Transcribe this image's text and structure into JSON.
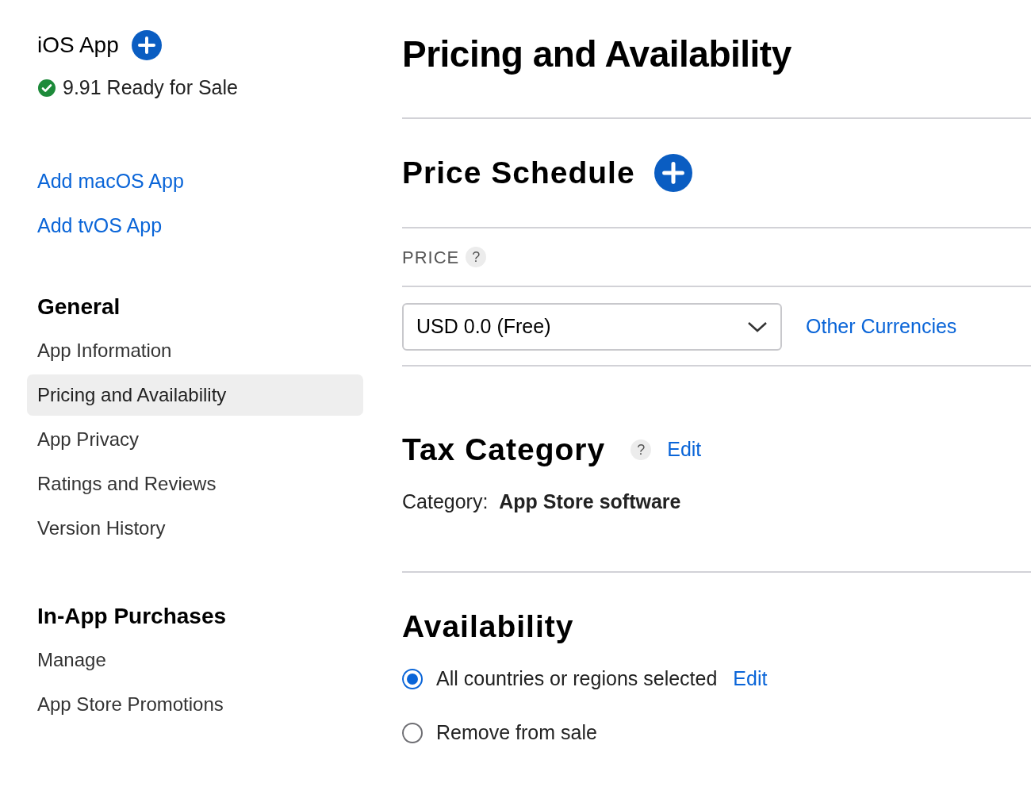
{
  "sidebar": {
    "app_title": "iOS App",
    "status": "9.91 Ready for Sale",
    "add_links": [
      "Add macOS App",
      "Add tvOS App"
    ],
    "groups": [
      {
        "heading": "General",
        "items": [
          {
            "label": "App Information",
            "selected": false
          },
          {
            "label": "Pricing and Availability",
            "selected": true
          },
          {
            "label": "App Privacy",
            "selected": false
          },
          {
            "label": "Ratings and Reviews",
            "selected": false
          },
          {
            "label": "Version History",
            "selected": false
          }
        ]
      },
      {
        "heading": "In-App Purchases",
        "items": [
          {
            "label": "Manage",
            "selected": false
          },
          {
            "label": "App Store Promotions",
            "selected": false
          }
        ]
      }
    ]
  },
  "page_title": "Pricing and Availability",
  "price_schedule": {
    "title": "Price Schedule",
    "price_label": "PRICE",
    "help": "?",
    "price_value": "USD 0.0 (Free)",
    "other_link": "Other Currencies"
  },
  "tax_category": {
    "title": "Tax Category",
    "help": "?",
    "edit": "Edit",
    "text": "Category:  **App Store software**"
  },
  "availability": {
    "title": "Availability",
    "options": [
      {
        "label": "All countries or regions selected",
        "selected": true,
        "edit": "Edit"
      },
      {
        "label": "Remove from sale",
        "selected": false
      }
    ]
  }
}
